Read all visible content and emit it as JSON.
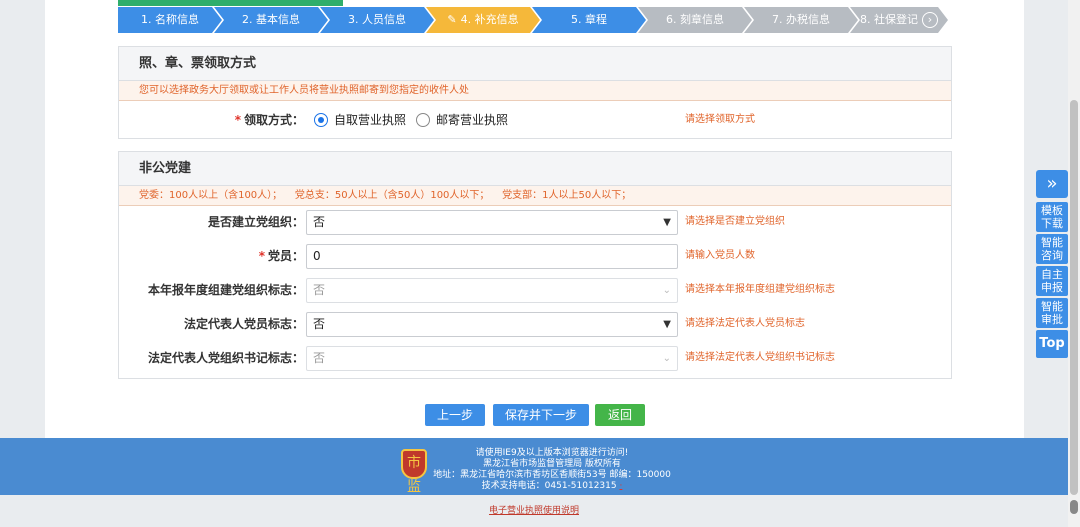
{
  "steps": [
    {
      "label": "1. 名称信息",
      "state": "done"
    },
    {
      "label": "2. 基本信息",
      "state": "done"
    },
    {
      "label": "3. 人员信息",
      "state": "done"
    },
    {
      "label": "4. 补充信息",
      "state": "active"
    },
    {
      "label": "5. 章程",
      "state": "done"
    },
    {
      "label": "6. 刻章信息",
      "state": "todo"
    },
    {
      "label": "7. 办税信息",
      "state": "todo"
    },
    {
      "label": "8. 社保登记",
      "state": "todo"
    }
  ],
  "pickup": {
    "title": "照、章、票领取方式",
    "note": "您可以选择政务大厅领取或让工作人员将营业执照邮寄到您指定的收件人处",
    "label": "领取方式",
    "options": [
      "自取营业执照",
      "邮寄营业执照"
    ],
    "selected": "自取营业执照",
    "hint": "请选择领取方式"
  },
  "party": {
    "title": "非公党建",
    "note": "党委：100人以上（含100人）；    党总支：50人以上（含50人）100人以下；    党支部：1人以上50人以下；",
    "fields": [
      {
        "label": "是否建立党组织：",
        "value": "否",
        "hint": "请选择是否建立党组织",
        "disabled": false,
        "required": false
      },
      {
        "label": "党员：",
        "value": "0",
        "hint": "请输入党员人数",
        "disabled": false,
        "required": true
      },
      {
        "label": "本年报年度组建党组织标志：",
        "value": "否",
        "hint": "请选择本年报年度组建党组织标志",
        "disabled": true,
        "required": false
      },
      {
        "label": "法定代表人党员标志：",
        "value": "否",
        "hint": "请选择法定代表人党员标志",
        "disabled": false,
        "required": false
      },
      {
        "label": "法定代表人党组织书记标志：",
        "value": "否",
        "hint": "请选择法定代表人党组织书记标志",
        "disabled": true,
        "required": false
      }
    ]
  },
  "buttons": {
    "prev": "上一步",
    "save_next": "保存并下一步",
    "back": "返回"
  },
  "footer": {
    "line1": "请使用IE9及以上版本浏览器进行访问!",
    "line2": "黑龙江省市场监督管理局 版权所有",
    "line3": "地址：黑龙江省哈尔滨市香坊区香顺街53号 邮编：150000",
    "line4": "技术支持电话：0451-51012315",
    "logo_text": "市监",
    "bottom_link": "电子营业执照使用说明"
  },
  "side": {
    "items": [
      "模板下载",
      "智能咨询",
      "自主申报",
      "智能审批"
    ],
    "top": "Top"
  },
  "colors": {
    "primary": "#3d8ee6",
    "active": "#f5b83a",
    "pending": "#b7bcc2",
    "hint": "#e0642b",
    "footer": "#4a8bd1"
  }
}
